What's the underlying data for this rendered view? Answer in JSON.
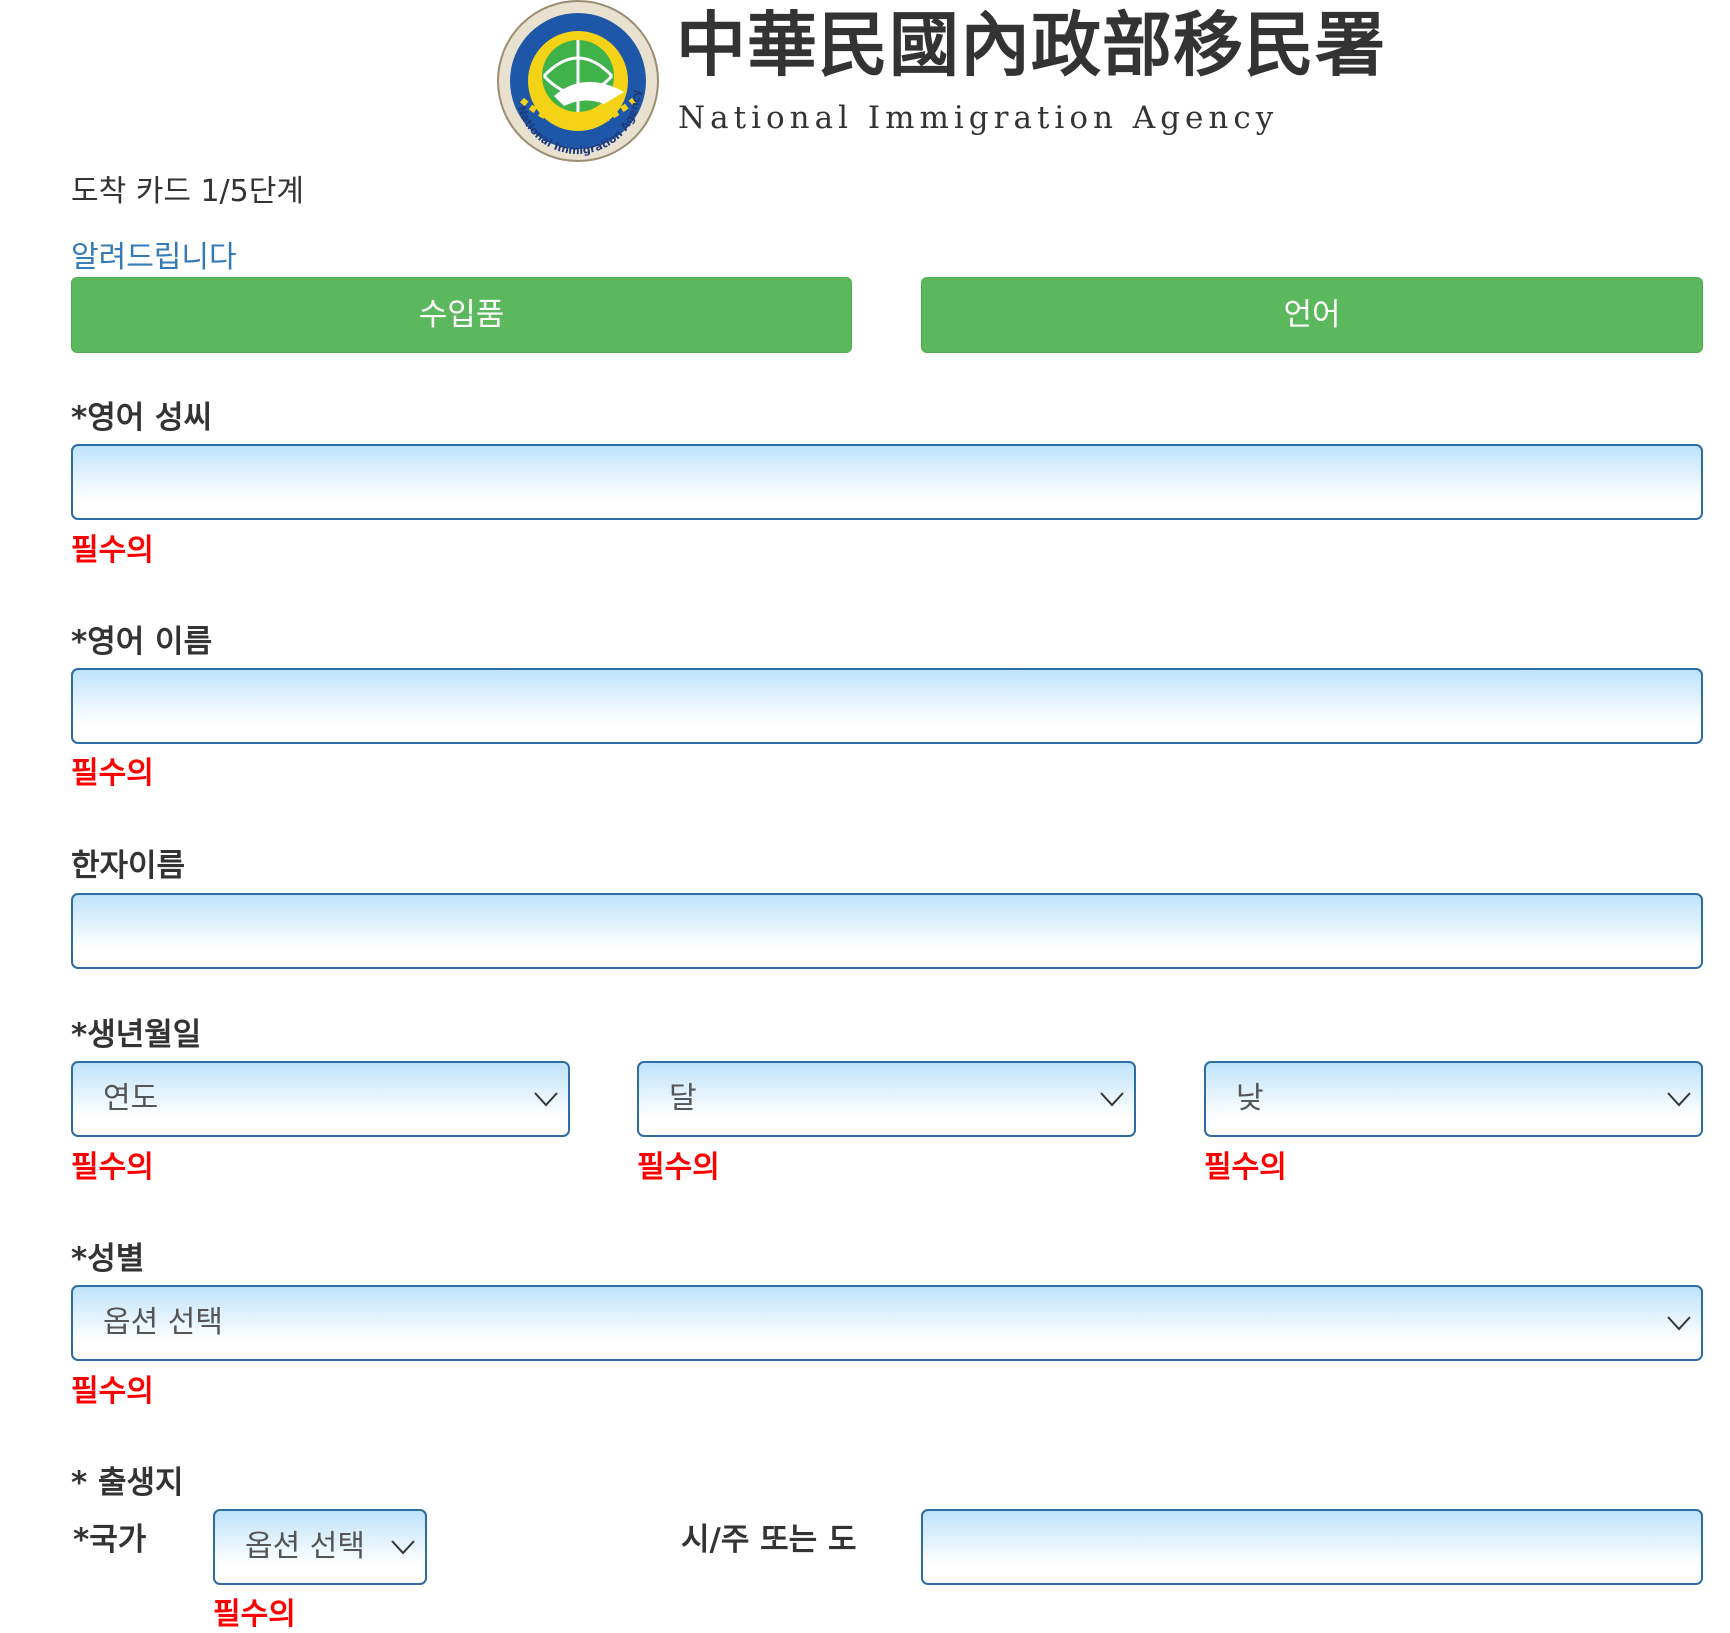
{
  "header": {
    "title_zh": "中華民國內政部移民署",
    "title_en": "National Immigration Agency",
    "emblem_text": "National Immigration Agency"
  },
  "step_label": "도착 카드 1/5단계",
  "notice_link": "알려드립니다",
  "buttons": {
    "import": "수입품",
    "language": "언어"
  },
  "form": {
    "surname": {
      "label": "*영어 성씨",
      "value": "",
      "required": "필수의"
    },
    "given_name": {
      "label": "*영어 이름",
      "value": "",
      "required": "필수의"
    },
    "chinese_name": {
      "label": "한자이름",
      "value": ""
    },
    "birth_date": {
      "label": "*생년월일",
      "year": {
        "value": "연도",
        "required": "필수의"
      },
      "month": {
        "value": "달",
        "required": "필수의"
      },
      "day": {
        "value": "낮",
        "required": "필수의"
      }
    },
    "gender": {
      "label": "*성별",
      "value": "옵션 선택",
      "required": "필수의"
    },
    "birthplace": {
      "label": "* 출생지",
      "country": {
        "label": "*국가",
        "value": "옵션 선택",
        "required": "필수의"
      },
      "city": {
        "label": "시/주 또는 도",
        "value": ""
      }
    }
  },
  "colors": {
    "primary_button": "#5cb85c",
    "link": "#337ab7",
    "required": "#ff0000",
    "input_border": "#2e6da4",
    "input_gradient_top": "#bfe3fb"
  },
  "icons": {
    "select_arrow": "chevron-down-icon"
  }
}
